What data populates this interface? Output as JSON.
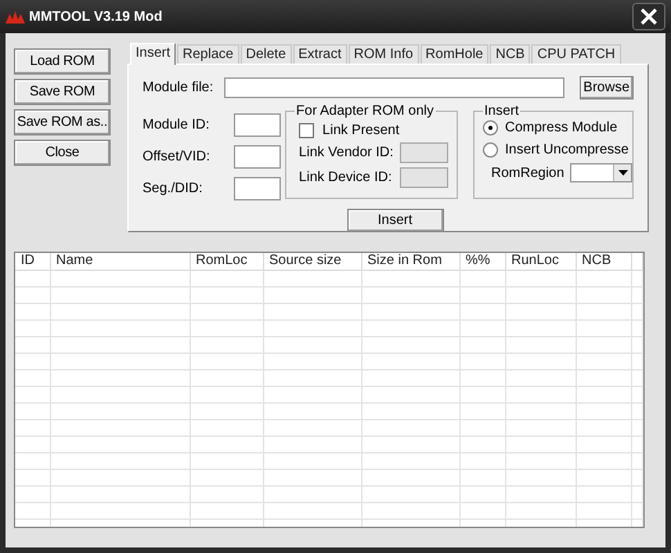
{
  "window": {
    "title": "MMTOOL V3.19 Mod"
  },
  "side_buttons": [
    "Load ROM",
    "Save ROM",
    "Save ROM as..",
    "Close"
  ],
  "tabs": [
    {
      "label": "Insert",
      "selected": true
    },
    {
      "label": "Replace",
      "selected": false
    },
    {
      "label": "Delete",
      "selected": false
    },
    {
      "label": "Extract",
      "selected": false
    },
    {
      "label": "ROM Info",
      "selected": false
    },
    {
      "label": "RomHole",
      "selected": false
    },
    {
      "label": "NCB",
      "selected": false
    },
    {
      "label": "CPU PATCH",
      "selected": false
    }
  ],
  "insert_panel": {
    "module_file": {
      "label": "Module file:"
    },
    "browse_button": "Browse",
    "fields": [
      {
        "label": "Module ID:"
      },
      {
        "label": "Offset/VID:"
      },
      {
        "label": "Seg./DID:"
      }
    ],
    "adapter_group": {
      "title": "For Adapter ROM only",
      "link_present": {
        "label": "Link Present",
        "checked": false
      },
      "fields": [
        {
          "label": "Link Vendor ID:",
          "disabled": true
        },
        {
          "label": "Link Device ID:",
          "disabled": true
        }
      ]
    },
    "insert_group": {
      "title": "Insert",
      "options": [
        {
          "label": "Compress Module",
          "selected": true
        },
        {
          "label": "Insert Uncompresse",
          "selected": false
        }
      ],
      "rom_region": {
        "label": "RomRegion"
      }
    },
    "insert_button": "Insert"
  },
  "table": {
    "columns": [
      "ID",
      "Name",
      "RomLoc",
      "Source size",
      "Size in Rom",
      "%%",
      "RunLoc",
      "NCB"
    ]
  }
}
